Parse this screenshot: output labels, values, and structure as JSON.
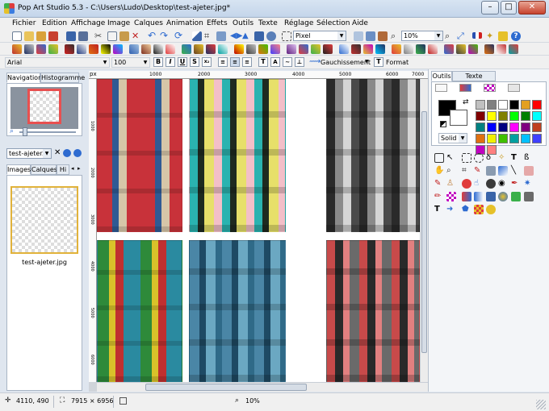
{
  "window": {
    "title": "Pop Art Studio 5.3 - C:\\Users\\Ludo\\Desktop\\test-ajeter.jpg*"
  },
  "menu": [
    "Fichier",
    "Edition",
    "Affichage",
    "Image",
    "Calques",
    "Animation",
    "Effets",
    "Outils",
    "Texte",
    "Réglage",
    "Sélection",
    "Aide"
  ],
  "toolbar": {
    "unit": "Pixel",
    "zoom": "10%"
  },
  "textbar": {
    "font": "Arial",
    "size": "100",
    "align_label": "Gauchissement",
    "format_label": "Format"
  },
  "left_panel": {
    "tabs_top": [
      "Navigation",
      "Histogramme"
    ],
    "file_select": "test-ajeter.jp",
    "tabs_bottom": [
      "Images",
      "Calques",
      "Hi"
    ],
    "thumbnail_label": "test-ajeter.jpg"
  },
  "ruler": {
    "unit": "px",
    "top_ticks": [
      "1000",
      "2000",
      "3000",
      "4000",
      "5000",
      "6000",
      "7000"
    ],
    "left_ticks": [
      "1000",
      "2000",
      "3000",
      "4000",
      "5000",
      "6000"
    ]
  },
  "right_panel": {
    "tabs": [
      "Outils",
      "Texte artistique"
    ],
    "fill_mode": "Solid"
  },
  "palette": [
    "#c0c0c0",
    "#808080",
    "#ffffff",
    "#000000",
    "#e3a020",
    "#ff0000",
    "#800000",
    "#ffff00",
    "#808000",
    "#00ff00",
    "#008000",
    "#00ffff",
    "#008080",
    "#0000ff",
    "#000080",
    "#ff00ff",
    "#800080",
    "#c04020",
    "#e07010",
    "#f0f000",
    "#40c000",
    "#00a0a0",
    "#00c0ff",
    "#4040ff",
    "#c000c0",
    "#ff8080"
  ],
  "colors": {
    "accent": "#3c7de0"
  },
  "statusbar": {
    "coords": "4110, 490",
    "size": "7915 × 6956",
    "zoom": "10%"
  }
}
